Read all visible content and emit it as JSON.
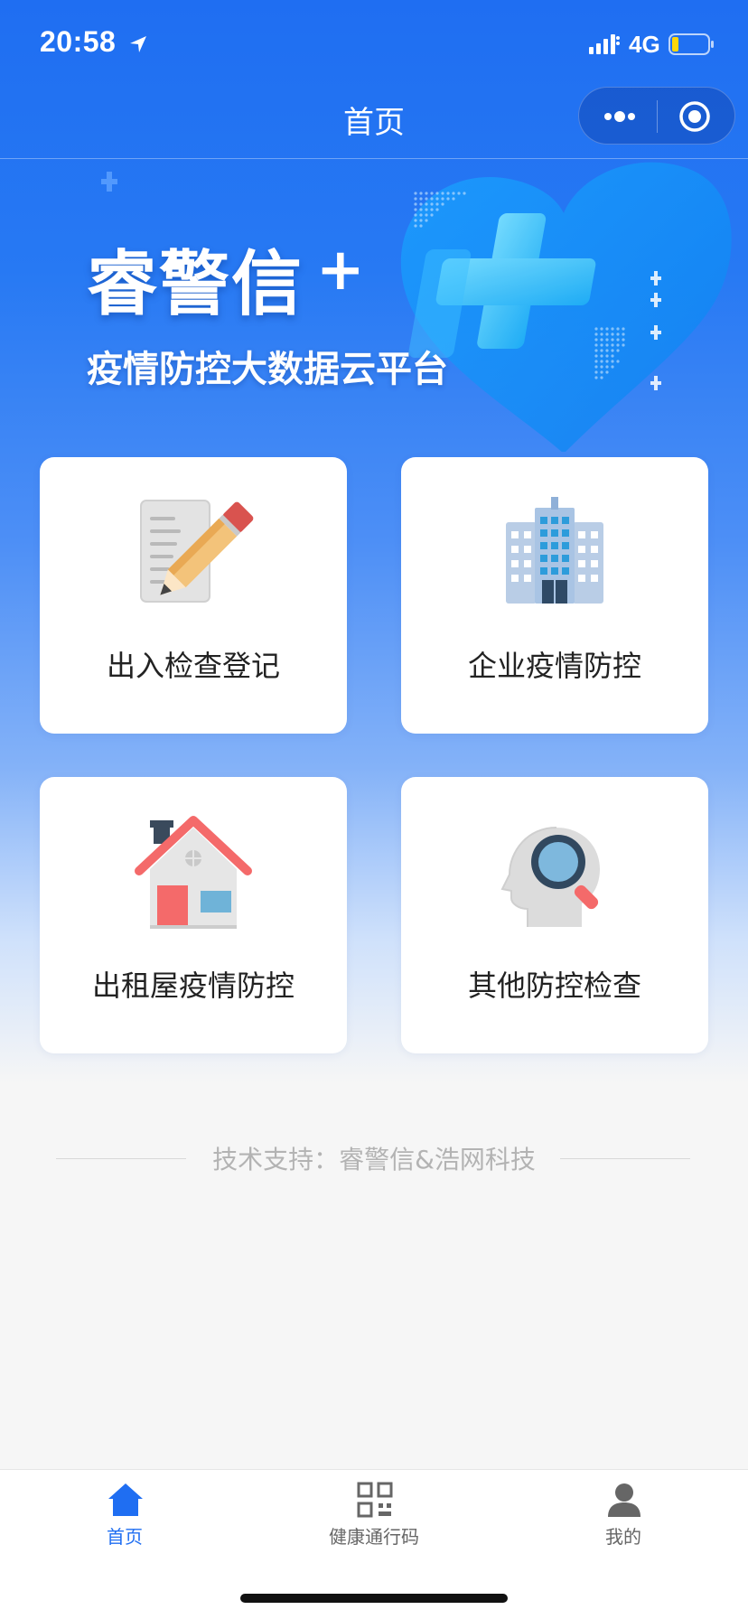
{
  "status_bar": {
    "time": "20:58",
    "network": "4G"
  },
  "nav": {
    "title": "首页"
  },
  "banner": {
    "title": "睿警信",
    "plus": "+",
    "subtitle": "疫情防控大数据云平台"
  },
  "cards": [
    {
      "label": "出入检查登记",
      "icon": "pencil-document-icon"
    },
    {
      "label": "企业疫情防控",
      "icon": "office-building-icon"
    },
    {
      "label": "出租屋疫情防控",
      "icon": "house-icon"
    },
    {
      "label": "其他防控检查",
      "icon": "head-magnifier-icon"
    }
  ],
  "support": {
    "text": "技术支持：睿警信&浩网科技"
  },
  "tabs": [
    {
      "label": "首页",
      "icon": "home-icon",
      "active": true
    },
    {
      "label": "健康通行码",
      "icon": "qr-code-icon",
      "active": false
    },
    {
      "label": "我的",
      "icon": "user-icon",
      "active": false
    }
  ],
  "colors": {
    "primary": "#1f6ef2",
    "background": "#f6f6f6",
    "card": "#ffffff",
    "tab_inactive": "#666666",
    "support_text": "#b3b3b3"
  }
}
